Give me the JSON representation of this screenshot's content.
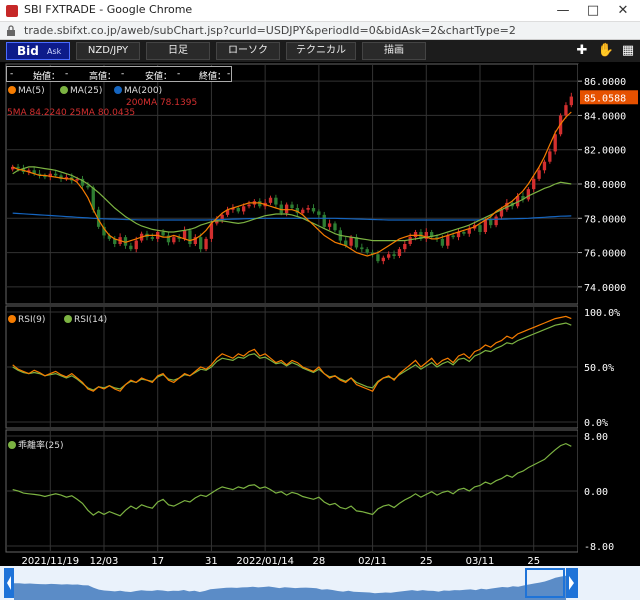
{
  "window": {
    "title": "SBI FXTRADE - Google Chrome",
    "url": "trade.sbifxt.co.jp/aweb/subChart.jsp?curId=USDJPY&periodId=0&bidAsk=2&chartType=2"
  },
  "toolbar": {
    "bid": "Bid",
    "ask": "Ask",
    "pair": "NZD/JPY",
    "period": "日足",
    "chart_type": "ローソク",
    "technical": "テクニカル",
    "draw": "描画"
  },
  "ohlc": {
    "open_label": "始値：",
    "open": "-",
    "high_label": "高値：",
    "high": "-",
    "low_label": "安値：",
    "low": "-",
    "close_label": "終値：",
    "close": "-",
    "sep": "-"
  },
  "legends": {
    "ma5": "MA(5)",
    "ma25": "MA(25)",
    "ma200": "MA(200)",
    "ma_values_1": "5MA 84.2240 25MA 80.0435",
    "ma_values_2": "200MA 78.1395",
    "rsi9": "RSI(9)",
    "rsi14": "RSI(14)",
    "dev": "乖離率(25)"
  },
  "colors": {
    "up": "#d32f2f",
    "down": "#2e7d32",
    "ma5": "#f57c00",
    "ma25": "#7cb342",
    "ma200": "#1565c0",
    "rsi9": "#f57c00",
    "rsi14": "#7cb342",
    "dev": "#7cb342",
    "current": "#e65100"
  },
  "chart_data": [
    {
      "type": "line",
      "subtype": "candlestick",
      "ylim": [
        73,
        87
      ],
      "yticks": [
        "86.0000",
        "84.0000",
        "82.0000",
        "80.0000",
        "78.0000",
        "76.0000",
        "74.0000"
      ],
      "ytick_values": [
        86,
        84,
        82,
        80,
        78,
        76,
        74
      ],
      "current_price": "85.0588",
      "current_value": 85.0588,
      "x_labels": [
        "2021/11/19",
        "12/03",
        "17",
        "31",
        "2022/01/14",
        "28",
        "02/11",
        "25",
        "03/11",
        "25"
      ],
      "x_label_index": [
        7,
        17,
        27,
        37,
        47,
        57,
        67,
        77,
        87,
        97
      ],
      "close": [
        81.0,
        80.9,
        80.7,
        80.8,
        80.6,
        80.5,
        80.4,
        80.6,
        80.5,
        80.3,
        80.4,
        80.2,
        80.3,
        79.9,
        79.8,
        78.5,
        77.5,
        77.0,
        76.8,
        76.5,
        76.9,
        76.4,
        76.2,
        76.7,
        77.1,
        76.9,
        76.8,
        77.2,
        77.0,
        76.6,
        76.9,
        76.8,
        77.3,
        76.5,
        76.9,
        76.2,
        76.8,
        77.7,
        77.9,
        78.2,
        78.5,
        78.6,
        78.4,
        78.7,
        78.8,
        79.0,
        78.7,
        78.9,
        79.2,
        78.8,
        78.3,
        78.8,
        78.6,
        78.3,
        78.5,
        78.6,
        78.4,
        78.2,
        77.5,
        77.7,
        77.3,
        76.7,
        76.4,
        76.9,
        76.3,
        76.2,
        76.0,
        75.9,
        75.5,
        75.7,
        75.9,
        75.8,
        76.2,
        76.5,
        76.9,
        77.2,
        76.8,
        77.2,
        76.9,
        76.8,
        76.4,
        77.0,
        76.9,
        77.2,
        77.1,
        77.4,
        77.6,
        77.2,
        77.9,
        77.6,
        78.1,
        78.5,
        78.9,
        78.7,
        79.3,
        79.1,
        79.7,
        80.3,
        80.8,
        81.3,
        81.9,
        82.9,
        84.0,
        84.6,
        85.1
      ],
      "ma5": [
        81.0,
        80.85,
        80.8,
        80.7,
        80.6,
        80.5,
        80.5,
        80.45,
        80.4,
        80.35,
        80.3,
        80.3,
        80.1,
        79.7,
        79.2,
        78.5,
        77.9,
        77.4,
        77.0,
        76.8,
        76.7,
        76.6,
        76.7,
        76.8,
        76.9,
        77.0,
        77.0,
        77.0,
        76.9,
        76.9,
        77.0,
        76.9,
        76.8,
        76.7,
        76.8,
        77.0,
        77.3,
        77.7,
        78.0,
        78.3,
        78.5,
        78.6,
        78.7,
        78.8,
        78.9,
        78.9,
        78.9,
        78.8,
        78.7,
        78.6,
        78.5,
        78.5,
        78.5,
        78.4,
        78.2,
        77.9,
        77.6,
        77.3,
        77.0,
        76.8,
        76.6,
        76.5,
        76.4,
        76.2,
        76.0,
        75.9,
        75.8,
        75.9,
        76.0,
        76.2,
        76.4,
        76.6,
        76.8,
        76.9,
        77.0,
        77.0,
        77.0,
        76.9,
        76.8,
        76.8,
        76.9,
        77.0,
        77.1,
        77.2,
        77.3,
        77.4,
        77.5,
        77.7,
        77.9,
        78.1,
        78.4,
        78.6,
        78.8,
        79.0,
        79.3,
        79.6,
        80.0,
        80.5,
        81.0,
        81.6,
        82.3,
        83.0,
        83.5,
        83.9,
        84.2
      ],
      "ma25": [
        80.6,
        80.8,
        80.9,
        81.0,
        81.0,
        80.95,
        80.9,
        80.85,
        80.8,
        80.7,
        80.6,
        80.5,
        80.35,
        80.2,
        80.0,
        79.75,
        79.5,
        79.2,
        78.9,
        78.6,
        78.35,
        78.1,
        77.9,
        77.7,
        77.55,
        77.45,
        77.35,
        77.3,
        77.25,
        77.2,
        77.2,
        77.25,
        77.3,
        77.35,
        77.45,
        77.6,
        77.7,
        77.8,
        77.85,
        77.85,
        77.8,
        77.75,
        77.7,
        77.75,
        77.85,
        77.95,
        78.05,
        78.15,
        78.2,
        78.25,
        78.25,
        78.25,
        78.2,
        78.1,
        78.0,
        77.85,
        77.7,
        77.55,
        77.4,
        77.25,
        77.1,
        77.0,
        76.95,
        76.9,
        76.85,
        76.8,
        76.75,
        76.7,
        76.7,
        76.7,
        76.7,
        76.7,
        76.7,
        76.7,
        76.75,
        76.8,
        76.85,
        76.9,
        76.95,
        77.0,
        77.1,
        77.2,
        77.3,
        77.4,
        77.5,
        77.6,
        77.75,
        77.9,
        78.05,
        78.2,
        78.35,
        78.5,
        78.65,
        78.8,
        78.95,
        79.1,
        79.3,
        79.45,
        79.6,
        79.75,
        79.85,
        80.0,
        80.1,
        80.05,
        80.0
      ],
      "ma200": [
        78.3,
        78.28,
        78.26,
        78.24,
        78.22,
        78.2,
        78.18,
        78.16,
        78.14,
        78.12,
        78.1,
        78.08,
        78.06,
        78.04,
        78.02,
        78.0,
        77.98,
        77.97,
        77.96,
        77.95,
        77.94,
        77.93,
        77.92,
        77.91,
        77.9,
        77.9,
        77.9,
        77.9,
        77.9,
        77.9,
        77.9,
        77.9,
        77.9,
        77.9,
        77.9,
        77.9,
        77.9,
        77.91,
        77.92,
        77.93,
        77.94,
        77.95,
        77.96,
        77.97,
        77.98,
        77.99,
        78.0,
        78.0,
        78.0,
        78.0,
        78.0,
        78.0,
        78.0,
        78.0,
        78.0,
        78.0,
        78.0,
        78.0,
        78.0,
        78.0,
        78.0,
        77.99,
        77.98,
        77.97,
        77.96,
        77.95,
        77.94,
        77.93,
        77.92,
        77.91,
        77.9,
        77.9,
        77.9,
        77.9,
        77.9,
        77.9,
        77.9,
        77.9,
        77.9,
        77.9,
        77.9,
        77.9,
        77.9,
        77.9,
        77.9,
        77.9,
        77.9,
        77.91,
        77.92,
        77.93,
        77.94,
        77.95,
        77.96,
        77.97,
        77.98,
        77.99,
        78.0,
        78.02,
        78.04,
        78.06,
        78.08,
        78.1,
        78.12,
        78.13,
        78.14
      ]
    },
    {
      "type": "line",
      "ylim": [
        0,
        100
      ],
      "yticks": [
        "100.0%",
        "50.0%",
        "0.0%"
      ],
      "ytick_values": [
        100,
        50,
        0
      ],
      "series": [
        {
          "name": "RSI(9)",
          "values": [
            52,
            48,
            46,
            44,
            47,
            45,
            42,
            44,
            46,
            43,
            41,
            44,
            40,
            36,
            30,
            28,
            32,
            30,
            33,
            30,
            28,
            34,
            38,
            36,
            40,
            38,
            36,
            42,
            44,
            38,
            36,
            40,
            44,
            42,
            46,
            50,
            48,
            52,
            58,
            62,
            60,
            58,
            62,
            60,
            64,
            66,
            60,
            62,
            58,
            54,
            56,
            52,
            56,
            54,
            50,
            48,
            46,
            50,
            44,
            40,
            42,
            38,
            36,
            40,
            34,
            32,
            30,
            28,
            36,
            40,
            42,
            38,
            44,
            48,
            52,
            56,
            50,
            54,
            58,
            52,
            56,
            58,
            54,
            60,
            62,
            58,
            64,
            66,
            70,
            68,
            72,
            74,
            78,
            76,
            80,
            82,
            84,
            86,
            88,
            90,
            92,
            94,
            95,
            96,
            94
          ]
        },
        {
          "name": "RSI(14)",
          "values": [
            50,
            47,
            45,
            44,
            45,
            44,
            42,
            43,
            44,
            42,
            40,
            42,
            39,
            35,
            31,
            29,
            32,
            31,
            33,
            31,
            30,
            34,
            37,
            36,
            39,
            38,
            37,
            41,
            43,
            39,
            38,
            40,
            43,
            42,
            45,
            48,
            47,
            50,
            55,
            58,
            57,
            56,
            59,
            58,
            61,
            62,
            58,
            59,
            56,
            53,
            54,
            51,
            54,
            52,
            49,
            47,
            45,
            48,
            44,
            41,
            42,
            39,
            37,
            40,
            36,
            34,
            32,
            31,
            37,
            40,
            41,
            39,
            43,
            46,
            49,
            52,
            48,
            51,
            54,
            50,
            53,
            55,
            52,
            57,
            58,
            55,
            60,
            62,
            65,
            64,
            67,
            69,
            72,
            71,
            74,
            76,
            78,
            80,
            82,
            84,
            86,
            88,
            89,
            90,
            88
          ]
        }
      ]
    },
    {
      "type": "line",
      "ylim": [
        -8,
        8
      ],
      "yticks": [
        "8.00",
        "0.00",
        "-8.00"
      ],
      "ytick_values": [
        8,
        0,
        -8
      ],
      "series": [
        {
          "name": "乖離率(25)",
          "values": [
            0.2,
            0.0,
            -0.3,
            -0.4,
            -0.5,
            -0.6,
            -0.8,
            -0.6,
            -0.4,
            -0.6,
            -0.9,
            -0.7,
            -1.2,
            -1.8,
            -2.8,
            -3.5,
            -3.0,
            -3.4,
            -3.0,
            -3.3,
            -3.6,
            -2.8,
            -2.2,
            -2.6,
            -2.0,
            -2.3,
            -2.5,
            -1.6,
            -1.2,
            -2.0,
            -2.2,
            -1.8,
            -1.4,
            -1.6,
            -1.0,
            -0.6,
            -0.8,
            -0.3,
            0.2,
            0.6,
            0.4,
            0.2,
            0.6,
            0.4,
            0.8,
            0.9,
            0.4,
            0.6,
            0.2,
            -0.3,
            -0.1,
            -0.6,
            -0.2,
            -0.4,
            -0.8,
            -1.0,
            -1.2,
            -0.9,
            -1.6,
            -2.0,
            -1.8,
            -2.4,
            -2.6,
            -2.2,
            -2.9,
            -3.0,
            -3.2,
            -3.4,
            -2.6,
            -2.2,
            -2.0,
            -2.4,
            -1.8,
            -1.3,
            -0.9,
            -0.4,
            -0.9,
            -0.5,
            -0.1,
            -0.6,
            -0.2,
            0.0,
            -0.4,
            0.2,
            0.4,
            0.0,
            0.6,
            0.8,
            1.3,
            1.0,
            1.5,
            1.8,
            2.3,
            2.0,
            2.6,
            2.9,
            3.4,
            3.8,
            4.2,
            4.6,
            5.3,
            6.0,
            6.6,
            6.9,
            6.5
          ]
        }
      ]
    }
  ]
}
